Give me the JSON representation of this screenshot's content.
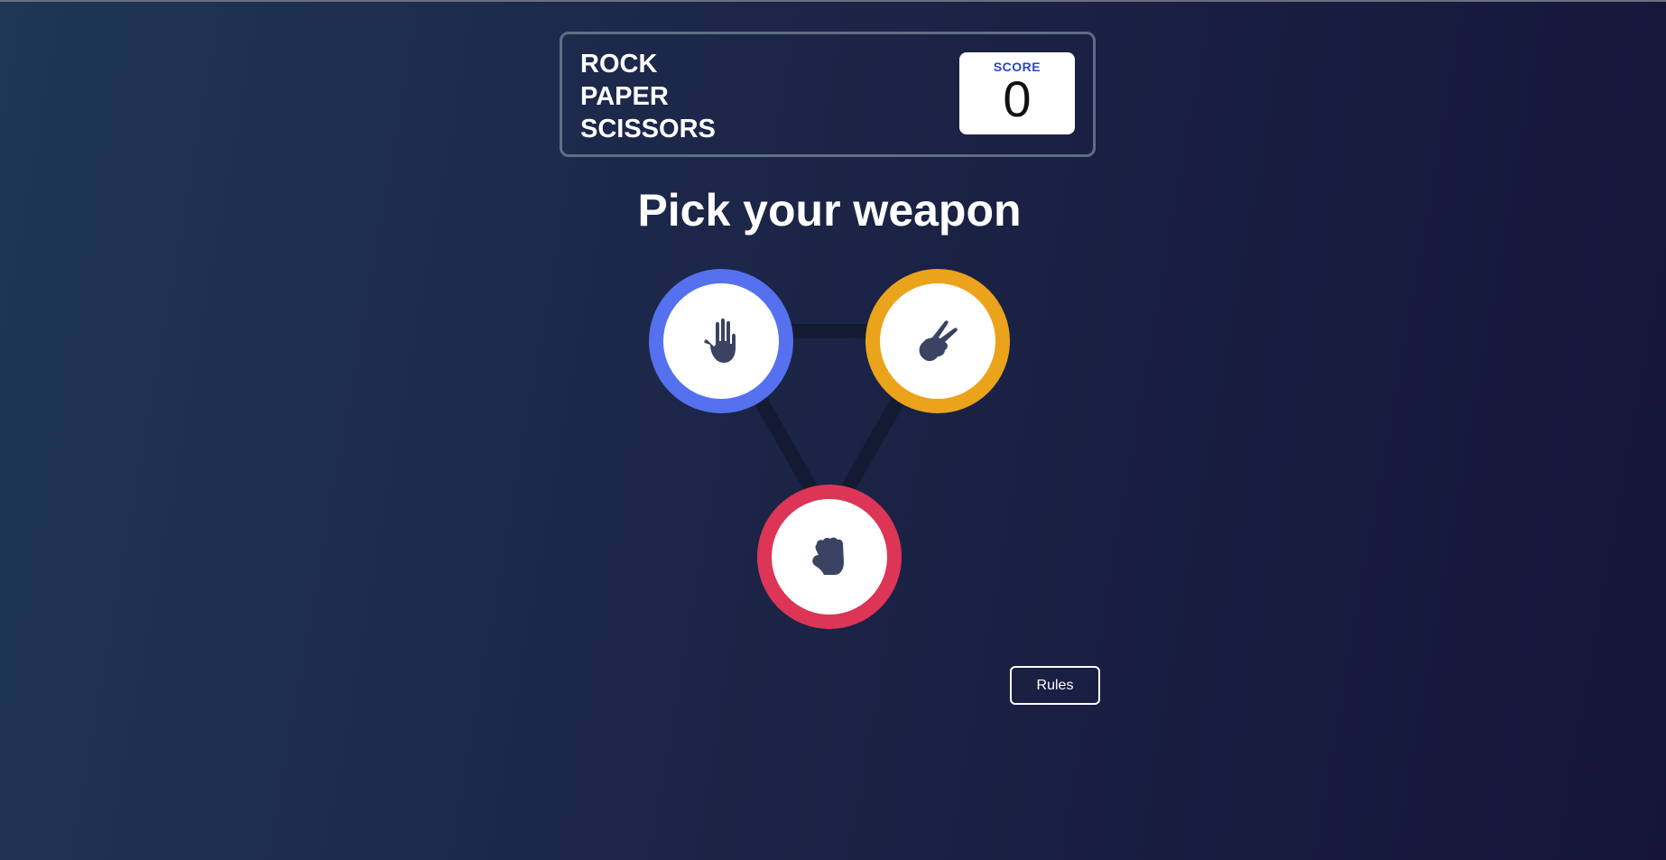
{
  "header": {
    "title_lines": [
      "ROCK",
      "PAPER",
      "SCISSORS"
    ],
    "score_label": "SCORE",
    "score_value": "0"
  },
  "main": {
    "heading": "Pick your weapon",
    "choices": [
      {
        "id": "paper",
        "icon": "hand-paper-icon",
        "ring_color": "#5571f0"
      },
      {
        "id": "scissors",
        "icon": "hand-scissors-icon",
        "ring_color": "#eba31c"
      },
      {
        "id": "rock",
        "icon": "hand-rock-icon",
        "ring_color": "#dd3556"
      }
    ]
  },
  "footer": {
    "rules_label": "Rules"
  },
  "colors": {
    "icon": "#3b4363",
    "connector": "#151a33"
  }
}
